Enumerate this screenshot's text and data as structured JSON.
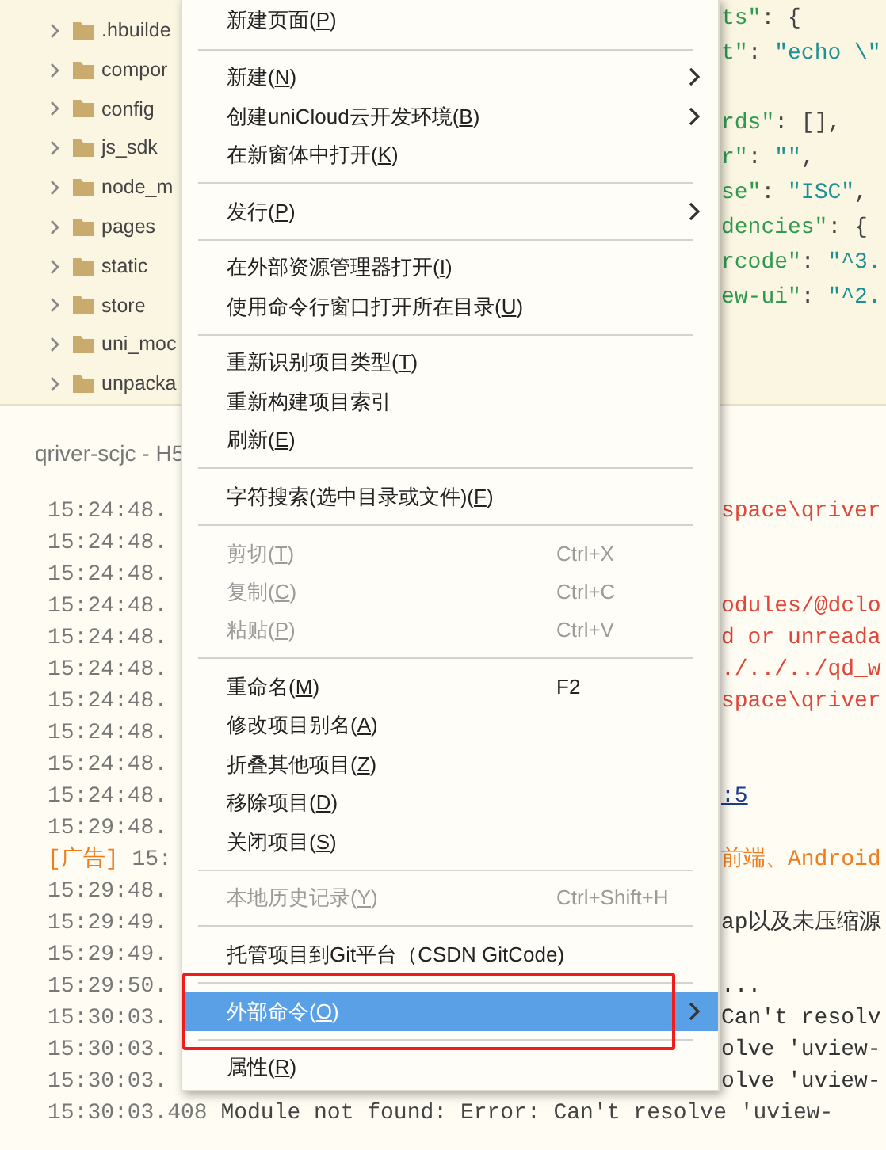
{
  "tree": {
    "items": [
      {
        "label": ".hbuilde",
        "expanded": false
      },
      {
        "label": "compor",
        "expanded": false
      },
      {
        "label": "config",
        "expanded": false
      },
      {
        "label": "js_sdk",
        "expanded": false
      },
      {
        "label": "node_m",
        "expanded": false
      },
      {
        "label": "pages",
        "expanded": false
      },
      {
        "label": "static",
        "expanded": false
      },
      {
        "label": "store",
        "expanded": false
      },
      {
        "label": "uni_moc",
        "expanded": false
      },
      {
        "label": "unpacka",
        "expanded": false
      }
    ]
  },
  "editor": {
    "lines": [
      [
        {
          "kind": "key",
          "text": "ts\""
        },
        {
          "kind": "punct",
          "text": ": {"
        }
      ],
      [
        {
          "kind": "key",
          "text": "t\""
        },
        {
          "kind": "punct",
          "text": ": "
        },
        {
          "kind": "string",
          "text": "\"echo \\\""
        }
      ],
      [
        {
          "kind": "key",
          "text": "rds\""
        },
        {
          "kind": "punct",
          "text": ": [],"
        }
      ],
      [
        {
          "kind": "key",
          "text": "r\""
        },
        {
          "kind": "punct",
          "text": ": "
        },
        {
          "kind": "string",
          "text": "\"\""
        },
        {
          "kind": "punct",
          "text": ","
        }
      ],
      [
        {
          "kind": "key",
          "text": "se\""
        },
        {
          "kind": "punct",
          "text": ": "
        },
        {
          "kind": "string",
          "text": "\"ISC\""
        },
        {
          "kind": "punct",
          "text": ","
        }
      ],
      [
        {
          "kind": "key",
          "text": "dencies\""
        },
        {
          "kind": "punct",
          "text": ": {"
        }
      ],
      [
        {
          "kind": "key",
          "text": "rcode\""
        },
        {
          "kind": "punct",
          "text": ": "
        },
        {
          "kind": "string",
          "text": "\"^3."
        }
      ],
      [
        {
          "kind": "key",
          "text": "ew-ui\""
        },
        {
          "kind": "punct",
          "text": ": "
        },
        {
          "kind": "string",
          "text": "\"^2."
        }
      ]
    ]
  },
  "console": {
    "title": "qriver-scjc - H5",
    "lines": [
      {
        "time": "15:24:48.",
        "kind": "error",
        "text": "space\\qriver"
      },
      {
        "time": "15:24:48.",
        "kind": "plain"
      },
      {
        "time": "15:24:48.",
        "kind": "plain"
      },
      {
        "time": "15:24:48.",
        "kind": "error",
        "text": "odules/@dclo"
      },
      {
        "time": "15:24:48.",
        "kind": "error",
        "text": "d or unreada"
      },
      {
        "time": "15:24:48.",
        "kind": "error",
        "text": "./../../qd_w"
      },
      {
        "time": "15:24:48.",
        "kind": "error",
        "text": "space\\qriver"
      },
      {
        "time": "15:24:48.",
        "kind": "plain"
      },
      {
        "time": "15:24:48.",
        "kind": "plain"
      },
      {
        "time": "15:24:48.",
        "kind": "link",
        "text": ":5"
      },
      {
        "time": "15:29:48.",
        "kind": "plain"
      },
      {
        "tag": "[广告]",
        "time": " 15:",
        "kind": "ad",
        "text": "前端、Android"
      },
      {
        "time": "15:29:48.",
        "kind": "plain"
      },
      {
        "time": "15:29:49.",
        "kind": "plain",
        "text": "ap以及未压缩源"
      },
      {
        "time": "15:29:49.",
        "kind": "plain"
      },
      {
        "time": "15:29:50.",
        "kind": "plain",
        "text": "..."
      },
      {
        "time": "15:30:03.",
        "kind": "plain",
        "text": "Can't resolv"
      },
      {
        "time": "15:30:03.",
        "kind": "plain",
        "text": "olve 'uview-"
      },
      {
        "time": "15:30:03.",
        "kind": "plain",
        "text": "olve 'uview-"
      },
      {
        "time": "15:30:03.408",
        "kind": "full",
        "text": "Module not found: Error: Can't resolve 'uview-"
      }
    ]
  },
  "context_menu": {
    "items": [
      {
        "kind": "item",
        "label": "新建页面(P)",
        "mnemonic": true,
        "submenu": false,
        "disabled": false,
        "selected": false
      },
      {
        "kind": "separator"
      },
      {
        "kind": "item",
        "label": "新建(N)",
        "mnemonic": true,
        "submenu": true,
        "disabled": false,
        "selected": false
      },
      {
        "kind": "item",
        "label": "创建uniCloud云开发环境(B)",
        "mnemonic": true,
        "submenu": true,
        "disabled": false,
        "selected": false
      },
      {
        "kind": "item",
        "label": "在新窗体中打开(K)",
        "mnemonic": true,
        "submenu": false,
        "disabled": false,
        "selected": false
      },
      {
        "kind": "separator"
      },
      {
        "kind": "item",
        "label": "发行(P)",
        "mnemonic": true,
        "submenu": true,
        "disabled": false,
        "selected": false
      },
      {
        "kind": "separator"
      },
      {
        "kind": "item",
        "label": "在外部资源管理器打开(I)",
        "mnemonic": true,
        "submenu": false,
        "disabled": false,
        "selected": false
      },
      {
        "kind": "item",
        "label": "使用命令行窗口打开所在目录(U)",
        "mnemonic": true,
        "submenu": false,
        "disabled": false,
        "selected": false
      },
      {
        "kind": "separator"
      },
      {
        "kind": "item",
        "label": "重新识别项目类型(T)",
        "mnemonic": true,
        "submenu": false,
        "disabled": false,
        "selected": false
      },
      {
        "kind": "item",
        "label": "重新构建项目索引",
        "submenu": false,
        "disabled": false,
        "selected": false
      },
      {
        "kind": "item",
        "label": "刷新(E)",
        "mnemonic": true,
        "submenu": false,
        "disabled": false,
        "selected": false
      },
      {
        "kind": "separator"
      },
      {
        "kind": "item",
        "label": "字符搜索(选中目录或文件)(F)",
        "mnemonic": true,
        "submenu": false,
        "disabled": false,
        "selected": false
      },
      {
        "kind": "separator"
      },
      {
        "kind": "item",
        "label": "剪切(T)",
        "mnemonic": true,
        "shortcut": "Ctrl+X",
        "submenu": false,
        "disabled": true,
        "selected": false
      },
      {
        "kind": "item",
        "label": "复制(C)",
        "mnemonic": true,
        "shortcut": "Ctrl+C",
        "submenu": false,
        "disabled": true,
        "selected": false
      },
      {
        "kind": "item",
        "label": "粘贴(P)",
        "mnemonic": true,
        "shortcut": "Ctrl+V",
        "submenu": false,
        "disabled": true,
        "selected": false
      },
      {
        "kind": "separator"
      },
      {
        "kind": "item",
        "label": "重命名(M)",
        "mnemonic": true,
        "shortcut": "F2",
        "submenu": false,
        "disabled": false,
        "selected": false
      },
      {
        "kind": "item",
        "label": "修改项目别名(A)",
        "mnemonic": true,
        "submenu": false,
        "disabled": false,
        "selected": false
      },
      {
        "kind": "item",
        "label": "折叠其他项目(Z)",
        "mnemonic": true,
        "submenu": false,
        "disabled": false,
        "selected": false
      },
      {
        "kind": "item",
        "label": "移除项目(D)",
        "mnemonic": true,
        "submenu": false,
        "disabled": false,
        "selected": false
      },
      {
        "kind": "item",
        "label": "关闭项目(S)",
        "mnemonic": true,
        "submenu": false,
        "disabled": false,
        "selected": false
      },
      {
        "kind": "separator"
      },
      {
        "kind": "item",
        "label": "本地历史记录(Y)",
        "mnemonic": true,
        "shortcut": "Ctrl+Shift+H",
        "submenu": false,
        "disabled": true,
        "selected": false
      },
      {
        "kind": "separator"
      },
      {
        "kind": "item",
        "label": "托管项目到Git平台（CSDN GitCode)",
        "submenu": false,
        "disabled": false,
        "selected": false
      },
      {
        "kind": "separator"
      },
      {
        "kind": "item",
        "label": "外部命令(O)",
        "mnemonic": true,
        "submenu": true,
        "disabled": false,
        "selected": true,
        "boxed": true
      },
      {
        "kind": "separator"
      },
      {
        "kind": "item",
        "label": "属性(R)",
        "mnemonic": true,
        "submenu": false,
        "disabled": false,
        "selected": false
      }
    ]
  }
}
